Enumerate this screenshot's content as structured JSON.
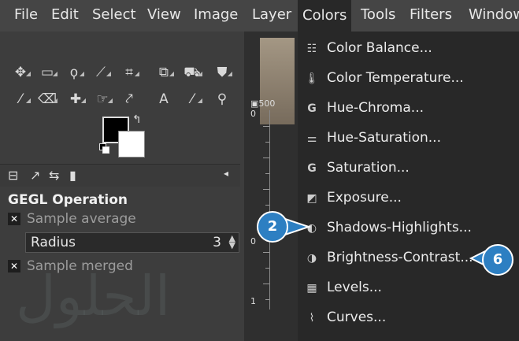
{
  "menubar": {
    "items": [
      "File",
      "Edit",
      "Select",
      "View",
      "Image",
      "Layer",
      "Colors",
      "Tools",
      "Filters",
      "Window"
    ],
    "active": "Colors"
  },
  "tool_options": {
    "title": "GEGL Operation",
    "sample_average": "Sample average",
    "radius_label": "Radius",
    "radius_value": "3",
    "sample_merged": "Sample merged"
  },
  "ruler": {
    "top_label": "500",
    "zero_left": "0",
    "zero_mid": "0",
    "one": "1"
  },
  "colors_menu": {
    "items": [
      {
        "label": "Color Balance...",
        "icon": "color-balance-icon"
      },
      {
        "label": "Color Temperature...",
        "icon": "thermometer-icon"
      },
      {
        "label": "Hue-Chroma...",
        "icon": "g-icon"
      },
      {
        "label": "Hue-Saturation...",
        "icon": "hue-saturation-icon"
      },
      {
        "label": "Saturation...",
        "icon": "g-icon"
      },
      {
        "label": "Exposure...",
        "icon": "exposure-icon"
      },
      {
        "label": "Shadows-Highlights...",
        "icon": "shadows-highlights-icon"
      },
      {
        "label": "Brightness-Contrast...",
        "icon": "brightness-contrast-icon"
      },
      {
        "label": "Levels...",
        "icon": "levels-icon"
      },
      {
        "label": "Curves...",
        "icon": "curves-icon"
      }
    ]
  },
  "callouts": {
    "step_a": "2",
    "step_b": "6"
  },
  "colors": {
    "callout_blue": "#2d7fc2",
    "menu_bg": "#282828",
    "fg_color": "#000000",
    "bg_color": "#ffffff"
  }
}
